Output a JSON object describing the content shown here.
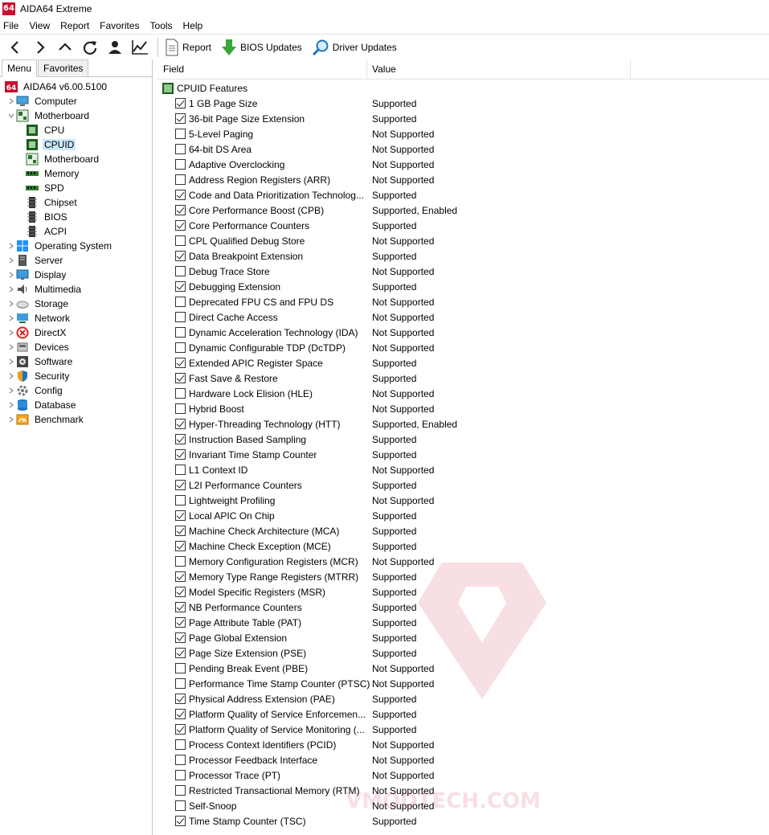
{
  "window": {
    "title": "AIDA64 Extreme",
    "logo_text": "64"
  },
  "menubar": {
    "items": [
      "File",
      "View",
      "Report",
      "Favorites",
      "Tools",
      "Help"
    ]
  },
  "toolbar": {
    "report_label": "Report",
    "bios_label": "BIOS Updates",
    "driver_label": "Driver Updates"
  },
  "tabs": {
    "menu": "Menu",
    "favorites": "Favorites"
  },
  "tree": [
    {
      "label": "AIDA64 v6.00.5100",
      "level": 0,
      "expand": "",
      "icon": "aida-logo-icon"
    },
    {
      "label": "Computer",
      "level": 1,
      "expand": ">",
      "icon": "computer-icon"
    },
    {
      "label": "Motherboard",
      "level": 1,
      "expand": "v",
      "icon": "motherboard-icon"
    },
    {
      "label": "CPU",
      "level": 2,
      "expand": "",
      "icon": "cpu-icon"
    },
    {
      "label": "CPUID",
      "level": 2,
      "expand": "",
      "icon": "cpuid-icon",
      "selected": true
    },
    {
      "label": "Motherboard",
      "level": 2,
      "expand": "",
      "icon": "motherboard-icon"
    },
    {
      "label": "Memory",
      "level": 2,
      "expand": "",
      "icon": "memory-icon"
    },
    {
      "label": "SPD",
      "level": 2,
      "expand": "",
      "icon": "spd-icon"
    },
    {
      "label": "Chipset",
      "level": 2,
      "expand": "",
      "icon": "chipset-icon"
    },
    {
      "label": "BIOS",
      "level": 2,
      "expand": "",
      "icon": "bios-icon"
    },
    {
      "label": "ACPI",
      "level": 2,
      "expand": "",
      "icon": "acpi-icon"
    },
    {
      "label": "Operating System",
      "level": 1,
      "expand": ">",
      "icon": "windows-icon"
    },
    {
      "label": "Server",
      "level": 1,
      "expand": ">",
      "icon": "server-icon"
    },
    {
      "label": "Display",
      "level": 1,
      "expand": ">",
      "icon": "display-icon"
    },
    {
      "label": "Multimedia",
      "level": 1,
      "expand": ">",
      "icon": "multimedia-icon"
    },
    {
      "label": "Storage",
      "level": 1,
      "expand": ">",
      "icon": "storage-icon"
    },
    {
      "label": "Network",
      "level": 1,
      "expand": ">",
      "icon": "network-icon"
    },
    {
      "label": "DirectX",
      "level": 1,
      "expand": ">",
      "icon": "directx-icon"
    },
    {
      "label": "Devices",
      "level": 1,
      "expand": ">",
      "icon": "devices-icon"
    },
    {
      "label": "Software",
      "level": 1,
      "expand": ">",
      "icon": "software-icon"
    },
    {
      "label": "Security",
      "level": 1,
      "expand": ">",
      "icon": "security-icon"
    },
    {
      "label": "Config",
      "level": 1,
      "expand": ">",
      "icon": "config-icon"
    },
    {
      "label": "Database",
      "level": 1,
      "expand": ">",
      "icon": "database-icon"
    },
    {
      "label": "Benchmark",
      "level": 1,
      "expand": ">",
      "icon": "benchmark-icon"
    }
  ],
  "table": {
    "headers": {
      "field": "Field",
      "value": "Value"
    },
    "group": "CPUID Features",
    "rows": [
      {
        "field": "1 GB Page Size",
        "checked": true,
        "value": "Supported"
      },
      {
        "field": "36-bit Page Size Extension",
        "checked": true,
        "value": "Supported"
      },
      {
        "field": "5-Level Paging",
        "checked": false,
        "value": "Not Supported"
      },
      {
        "field": "64-bit DS Area",
        "checked": false,
        "value": "Not Supported"
      },
      {
        "field": "Adaptive Overclocking",
        "checked": false,
        "value": "Not Supported"
      },
      {
        "field": "Address Region Registers (ARR)",
        "checked": false,
        "value": "Not Supported"
      },
      {
        "field": "Code and Data Prioritization Technolog...",
        "checked": true,
        "value": "Supported"
      },
      {
        "field": "Core Performance Boost (CPB)",
        "checked": true,
        "value": "Supported, Enabled"
      },
      {
        "field": "Core Performance Counters",
        "checked": true,
        "value": "Supported"
      },
      {
        "field": "CPL Qualified Debug Store",
        "checked": false,
        "value": "Not Supported"
      },
      {
        "field": "Data Breakpoint Extension",
        "checked": true,
        "value": "Supported"
      },
      {
        "field": "Debug Trace Store",
        "checked": false,
        "value": "Not Supported"
      },
      {
        "field": "Debugging Extension",
        "checked": true,
        "value": "Supported"
      },
      {
        "field": "Deprecated FPU CS and FPU DS",
        "checked": false,
        "value": "Not Supported"
      },
      {
        "field": "Direct Cache Access",
        "checked": false,
        "value": "Not Supported"
      },
      {
        "field": "Dynamic Acceleration Technology (IDA)",
        "checked": false,
        "value": "Not Supported"
      },
      {
        "field": "Dynamic Configurable TDP (DcTDP)",
        "checked": false,
        "value": "Not Supported"
      },
      {
        "field": "Extended APIC Register Space",
        "checked": true,
        "value": "Supported"
      },
      {
        "field": "Fast Save & Restore",
        "checked": true,
        "value": "Supported"
      },
      {
        "field": "Hardware Lock Elision (HLE)",
        "checked": false,
        "value": "Not Supported"
      },
      {
        "field": "Hybrid Boost",
        "checked": false,
        "value": "Not Supported"
      },
      {
        "field": "Hyper-Threading Technology (HTT)",
        "checked": true,
        "value": "Supported, Enabled"
      },
      {
        "field": "Instruction Based Sampling",
        "checked": true,
        "value": "Supported"
      },
      {
        "field": "Invariant Time Stamp Counter",
        "checked": true,
        "value": "Supported"
      },
      {
        "field": "L1 Context ID",
        "checked": false,
        "value": "Not Supported"
      },
      {
        "field": "L2I Performance Counters",
        "checked": true,
        "value": "Supported"
      },
      {
        "field": "Lightweight Profiling",
        "checked": false,
        "value": "Not Supported"
      },
      {
        "field": "Local APIC On Chip",
        "checked": true,
        "value": "Supported"
      },
      {
        "field": "Machine Check Architecture (MCA)",
        "checked": true,
        "value": "Supported"
      },
      {
        "field": "Machine Check Exception (MCE)",
        "checked": true,
        "value": "Supported"
      },
      {
        "field": "Memory Configuration Registers (MCR)",
        "checked": false,
        "value": "Not Supported"
      },
      {
        "field": "Memory Type Range Registers (MTRR)",
        "checked": true,
        "value": "Supported"
      },
      {
        "field": "Model Specific Registers (MSR)",
        "checked": true,
        "value": "Supported"
      },
      {
        "field": "NB Performance Counters",
        "checked": true,
        "value": "Supported"
      },
      {
        "field": "Page Attribute Table (PAT)",
        "checked": true,
        "value": "Supported"
      },
      {
        "field": "Page Global Extension",
        "checked": true,
        "value": "Supported"
      },
      {
        "field": "Page Size Extension (PSE)",
        "checked": true,
        "value": "Supported"
      },
      {
        "field": "Pending Break Event (PBE)",
        "checked": false,
        "value": "Not Supported"
      },
      {
        "field": "Performance Time Stamp Counter (PTSC)",
        "checked": false,
        "value": "Not Supported"
      },
      {
        "field": "Physical Address Extension (PAE)",
        "checked": true,
        "value": "Supported"
      },
      {
        "field": "Platform Quality of Service Enforcemen...",
        "checked": true,
        "value": "Supported"
      },
      {
        "field": "Platform Quality of Service Monitoring (...",
        "checked": true,
        "value": "Supported"
      },
      {
        "field": "Process Context Identifiers (PCID)",
        "checked": false,
        "value": "Not Supported"
      },
      {
        "field": "Processor Feedback Interface",
        "checked": false,
        "value": "Not Supported"
      },
      {
        "field": "Processor Trace (PT)",
        "checked": false,
        "value": "Not Supported"
      },
      {
        "field": "Restricted Transactional Memory (RTM)",
        "checked": false,
        "value": "Not Supported"
      },
      {
        "field": "Self-Snoop",
        "checked": false,
        "value": "Not Supported"
      },
      {
        "field": "Time Stamp Counter (TSC)",
        "checked": true,
        "value": "Supported"
      }
    ]
  },
  "watermark": {
    "text": "VMODTECH.COM"
  },
  "colors": {
    "selection": "#cce8ff",
    "logo_red": "#c8102e",
    "bios_green": "#3aa53a",
    "driver_blue": "#1e73be"
  }
}
